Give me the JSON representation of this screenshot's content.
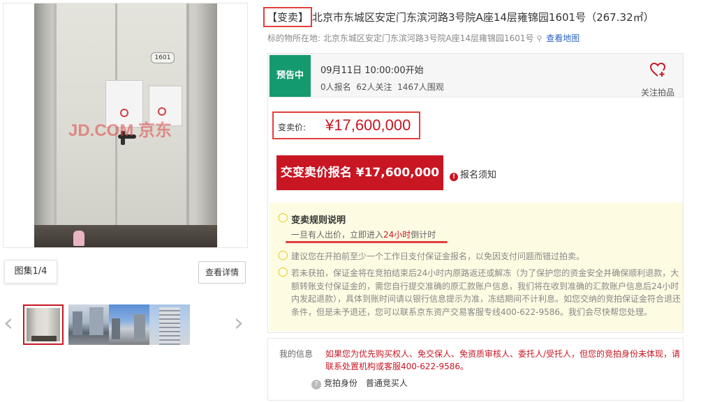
{
  "lot": {
    "tag": "【变卖】",
    "title": "北京市东城区安定门东滨河路3号院A座14层雍锦园1601号（267.32㎡）",
    "location_label": "标的物所在地:",
    "location_value": "北京东城区安定门东滨河路3号院A座14层雍锦园1601号",
    "map_link": "查看地图"
  },
  "gallery": {
    "door_number": "1601",
    "watermark": "JD.COM 京东",
    "counter": "图集1/4",
    "details_button": "查看详情",
    "thumbnail_count": 4,
    "active_thumbnail": 1
  },
  "status": {
    "badge": "预告中",
    "badge_color": "#139a6e",
    "start_time": "09月11日 10:00:00开始",
    "stats": "0人报名  62人关注  1467人围观",
    "follow_label": "关注拍品"
  },
  "price": {
    "label": "变卖价:",
    "value": "¥17,600,000"
  },
  "bid_button": "交变卖价报名 ¥17,600,000",
  "notice_link": "报名须知",
  "rules": {
    "title": "变卖规则说明",
    "main_prefix": "一旦有人出价，立即进入",
    "main_highlight": "24小时",
    "main_suffix": "倒计时",
    "tip": "建议您在开拍前至少一个工作日支付保证金报名，以免因支付问题而错过拍卖。",
    "refund": "若未获拍，保证金将在竞拍结束后24小时内原路返还或解冻（为了保护您的资金安全并确保顺利退款，大额转账支付保证金的，需您自行提交准确的原汇款账户信息，我们将在收到准确的汇款账户信息后24小时内发起退款），具体到账时间请以银行信息提示为准，冻结期间不计利息。如您交纳的竞拍保证金符合退还条件，但是未予退还，您可以联系京东资产交易客服专线400-622-9586。我们会尽快帮您处理。"
  },
  "my_info": {
    "label": "我的信息",
    "message": "如果您为优先购买权人、免交保人、免资质审核人、委托人/受托人，但您的竞拍身份未体现，请联系处置机构或客服400-622-9586。",
    "identity_label": "竞拍身份",
    "identity_value": "普通竞买人"
  },
  "colors": {
    "accent_red": "#c81623",
    "highlight_border": "#e53e3e",
    "rules_bg": "#fdfbe2",
    "link_blue": "#2a63c4"
  },
  "icons": [
    "location-pin-icon",
    "heart-plus-icon",
    "exclamation-icon",
    "lightbulb-icon",
    "question-icon",
    "chevron-left-icon",
    "chevron-right-icon"
  ]
}
